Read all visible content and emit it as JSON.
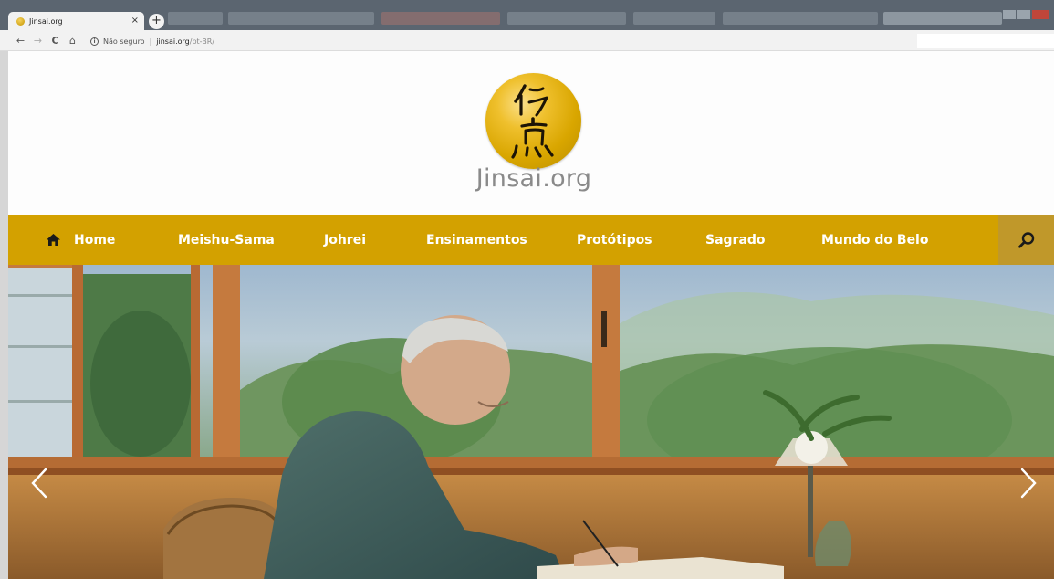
{
  "browser": {
    "tab_title": "Jinsai.org",
    "tab_close": "×",
    "new_tab": "+",
    "nav": {
      "back": "←",
      "forward": "→",
      "reload": "C",
      "home": "⌂"
    },
    "security": "Não seguro",
    "url_host": "jinsai.org",
    "url_path": "/pt-BR/"
  },
  "site": {
    "brand": "Jinsai.org",
    "nav_items": [
      {
        "label": "Home",
        "icon": "home-icon"
      },
      {
        "label": "Meishu-Sama"
      },
      {
        "label": "Johrei"
      },
      {
        "label": "Ensinamentos"
      },
      {
        "label": "Protótipos"
      },
      {
        "label": "Sagrado"
      },
      {
        "label": "Mundo do Belo"
      }
    ],
    "search_icon": "search-icon"
  },
  "slider": {
    "prev_icon": "chevron-left-icon",
    "next_icon": "chevron-right-icon",
    "image": "elderly man in green kimono writing at a desk beside large windows overlooking green hills"
  },
  "colors": {
    "nav_bg": "#d3a100",
    "search_bg": "#c0982a",
    "logo_gold": "#e2b30f",
    "brand_text": "#8a8a8a"
  }
}
